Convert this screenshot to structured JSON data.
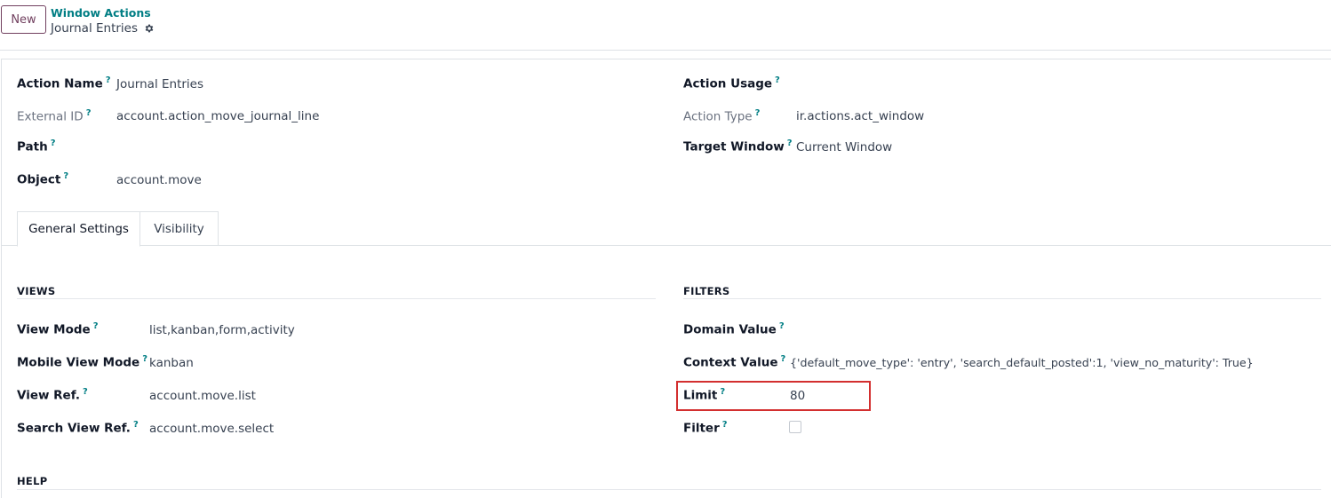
{
  "control_panel": {
    "new_button": "New",
    "breadcrumb_parent": "Window Actions",
    "breadcrumb_current": "Journal Entries"
  },
  "header_fields": {
    "action_name": {
      "label": "Action Name",
      "value": "Journal Entries"
    },
    "external_id": {
      "label": "External ID",
      "value": "account.action_move_journal_line"
    },
    "path": {
      "label": "Path",
      "value": ""
    },
    "object": {
      "label": "Object",
      "value": "account.move"
    },
    "action_usage": {
      "label": "Action Usage",
      "value": ""
    },
    "action_type": {
      "label": "Action Type",
      "value": "ir.actions.act_window"
    },
    "target_window": {
      "label": "Target Window",
      "value": "Current Window"
    }
  },
  "tabs": [
    {
      "label": "General Settings",
      "active": true
    },
    {
      "label": "Visibility",
      "active": false
    }
  ],
  "views": {
    "title": "VIEWS",
    "view_mode": {
      "label": "View Mode",
      "value": "list,kanban,form,activity"
    },
    "mobile_view_mode": {
      "label": "Mobile View Mode",
      "value": "kanban"
    },
    "view_ref": {
      "label": "View Ref.",
      "value": "account.move.list"
    },
    "search_view_ref": {
      "label": "Search View Ref.",
      "value": "account.move.select"
    }
  },
  "filters": {
    "title": "FILTERS",
    "domain_value": {
      "label": "Domain Value",
      "value": ""
    },
    "context_value": {
      "label": "Context Value",
      "value": "{'default_move_type': 'entry', 'search_default_posted':1, 'view_no_maturity': True}"
    },
    "limit": {
      "label": "Limit",
      "value": "80"
    },
    "filter": {
      "label": "Filter",
      "checked": false
    }
  },
  "help": {
    "title": "HELP"
  },
  "tooltip_mark": "?",
  "colors": {
    "accent": "#017e84",
    "primary": "#71405f",
    "highlight": "#d32f2f"
  }
}
